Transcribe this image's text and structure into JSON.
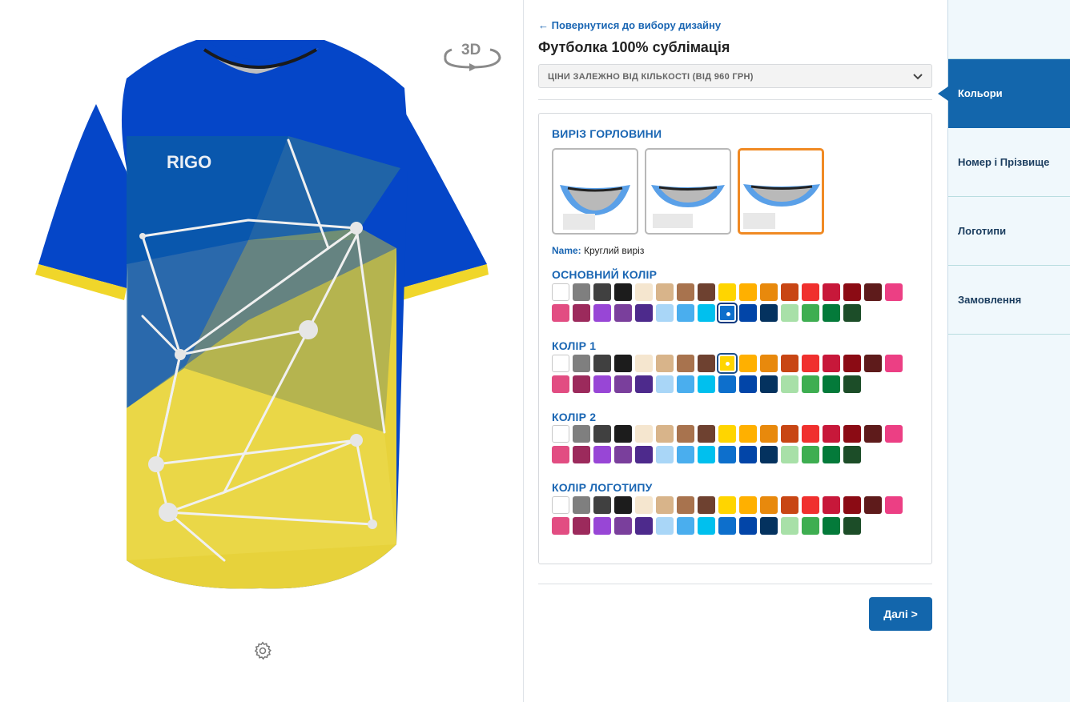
{
  "preview": {
    "brand_logo": "RIGO",
    "rotate_label": "3D",
    "icons": {
      "rotate": "rotate-3d-icon",
      "settings": "gear-icon"
    }
  },
  "config": {
    "back_link": "← Повернутися до вибору дизайну",
    "product_title": "Футболка 100% сублімація",
    "price_select": "ЦІНИ ЗАЛЕЖНО ВІД КІЛЬКОСТІ (ВІД 960 ГРН)",
    "neckline": {
      "title": "ВИРІЗ ГОРЛОВИНИ",
      "options_count_selected_index": 2,
      "name_label": "Name:",
      "name_value": "Круглий виріз"
    },
    "palette": [
      "#ffffff",
      "#7f7f7f",
      "#404040",
      "#1c1c1c",
      "#f5e6cf",
      "#d8b48a",
      "#a8734e",
      "#6e4130",
      "#ffd500",
      "#ffb000",
      "#e8890c",
      "#c84614",
      "#f0302e",
      "#c7183a",
      "#8b0b14",
      "#5e1b1b",
      "#ec3f84",
      "#e24d82",
      "#9c2a5c",
      "#9846d6",
      "#7a3f9c",
      "#4d2a8c",
      "#a9d6f7",
      "#4aaeee",
      "#00c0ee",
      "#0d6fcc",
      "#0245a8",
      "#04325f",
      "#a8e0a8",
      "#3eae51",
      "#047a3a",
      "#1c4d28"
    ],
    "sections": [
      {
        "title": "ОСНОВНИЙ КОЛІР",
        "selected_index": 25
      },
      {
        "title": "КОЛІР 1",
        "selected_index": 8
      },
      {
        "title": "КОЛІР 2",
        "selected_index": 0
      },
      {
        "title": "КОЛІР ЛОГОТИПУ",
        "selected_index": 0
      }
    ],
    "next_button": "Далі >"
  },
  "side_nav": {
    "items": [
      {
        "label": "Кольори",
        "active": true
      },
      {
        "label": "Номер і Прізвище",
        "active": false
      },
      {
        "label": "Логотипи",
        "active": false
      },
      {
        "label": "Замовлення",
        "active": false
      }
    ]
  },
  "colors": {
    "accent": "#1366ac",
    "link": "#1a66b3",
    "selected_border": "#f08a24"
  }
}
